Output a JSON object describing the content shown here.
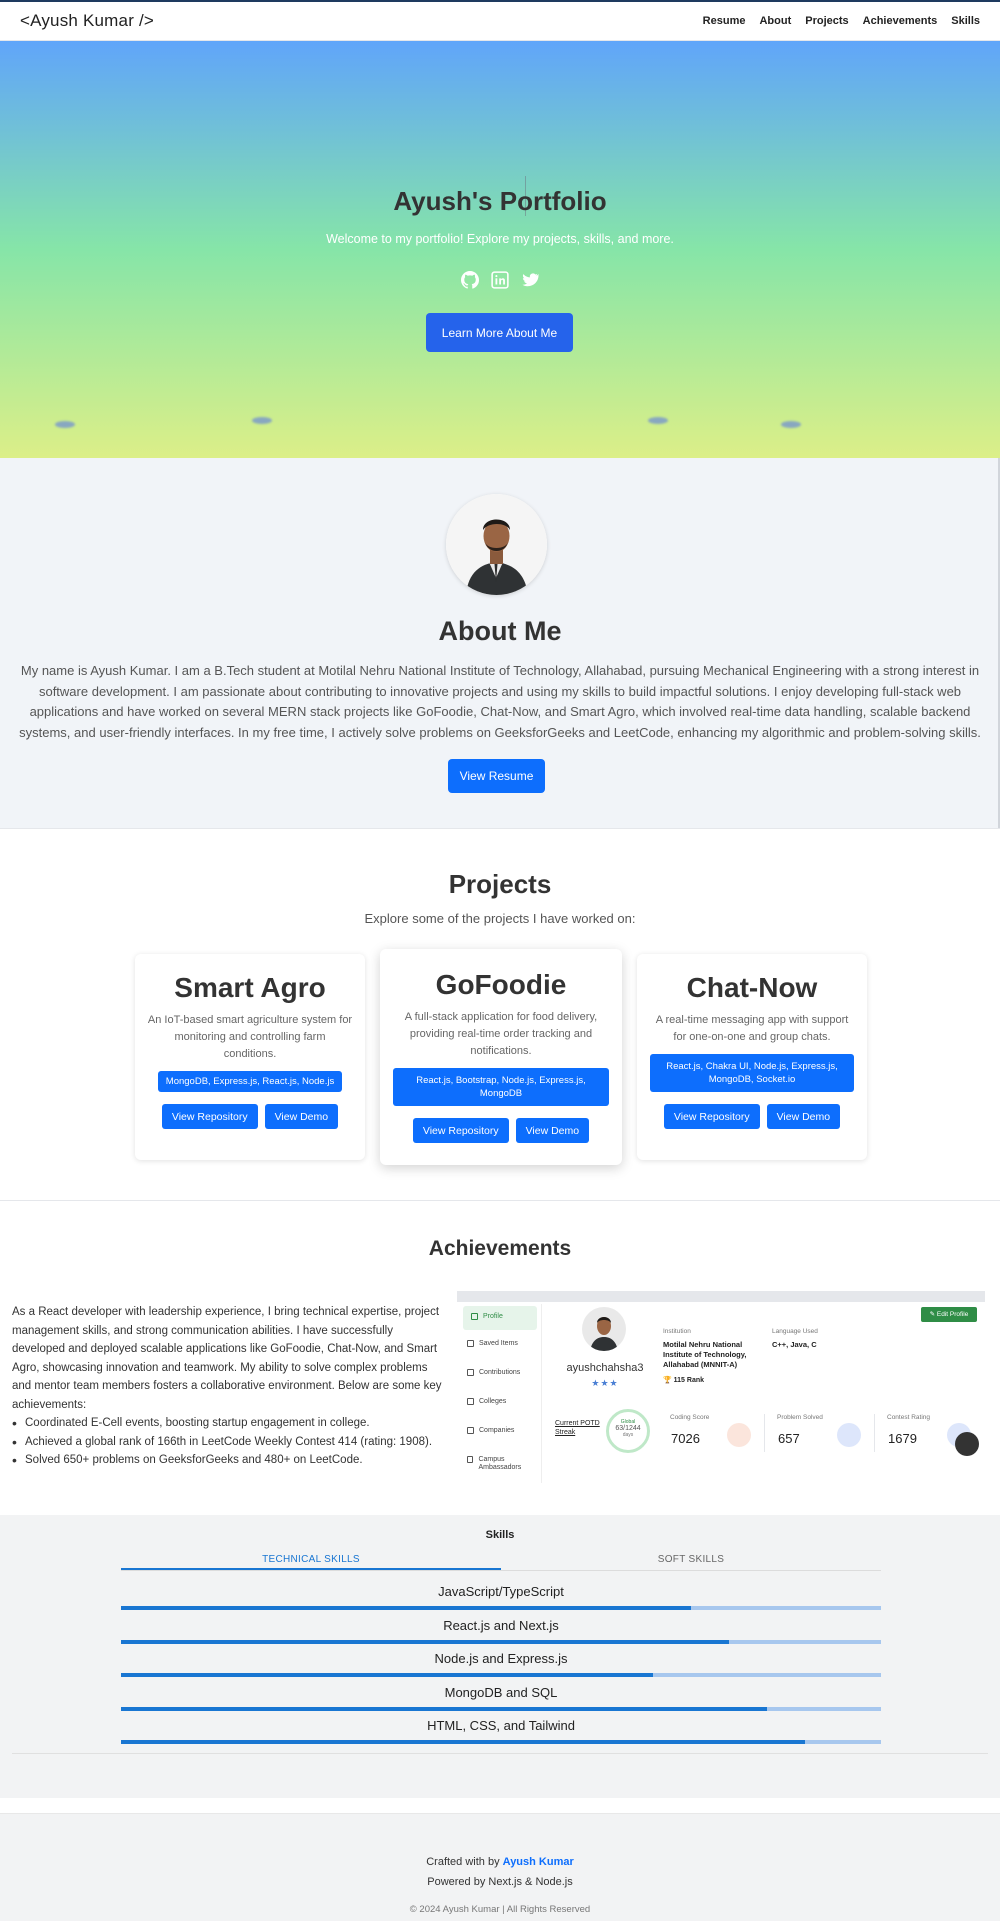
{
  "nav": {
    "brand": "<Ayush Kumar />",
    "links": [
      "Resume",
      "About",
      "Projects",
      "Achievements",
      "Skills"
    ]
  },
  "hero": {
    "title": "Ayush's Portfolio",
    "subtitle": "Welcome to my portfolio! Explore my projects, skills, and more.",
    "icons": [
      "github-icon",
      "linkedin-icon",
      "twitter-icon"
    ],
    "button": "Learn More About Me",
    "gradient": [
      "#60a5fa",
      "#86e5a8",
      "#dcef88"
    ]
  },
  "about": {
    "title": "About Me",
    "text": "My name is Ayush Kumar. I am a B.Tech student at Motilal Nehru National Institute of Technology, Allahabad, pursuing Mechanical Engineering with a strong interest in software development. I am passionate about contributing to innovative projects and using my skills to build impactful solutions. I enjoy developing full-stack web applications and have worked on several MERN stack projects like GoFoodie, Chat-Now, and Smart Agro, which involved real-time data handling, scalable backend systems, and user-friendly interfaces. In my free time, I actively solve problems on GeeksforGeeks and LeetCode, enhancing my algorithmic and problem-solving skills.",
    "button": "View Resume"
  },
  "projects": {
    "title": "Projects",
    "subtitle": "Explore some of the projects I have worked on:",
    "items": [
      {
        "name": "Smart Agro",
        "desc": "An IoT-based smart agriculture system for monitoring and controlling farm conditions.",
        "tech": "MongoDB, Express.js, React.js, Node.js",
        "repo": "View Repository",
        "demo": "View Demo"
      },
      {
        "name": "GoFoodie",
        "desc": "A full-stack application for food delivery, providing real-time order tracking and notifications.",
        "tech": "React.js, Bootstrap, Node.js, Express.js, MongoDB",
        "repo": "View Repository",
        "demo": "View Demo"
      },
      {
        "name": "Chat-Now",
        "desc": "A real-time messaging app with support for one-on-one and group chats.",
        "tech": "React.js, Chakra UI, Node.js, Express.js, MongoDB, Socket.io",
        "repo": "View Repository",
        "demo": "View Demo"
      }
    ]
  },
  "achievements": {
    "title": "Achievements",
    "intro": "As a React developer with leadership experience, I bring technical expertise, project management skills, and strong communication abilities. I have successfully developed and deployed scalable applications like GoFoodie, Chat-Now, and Smart Agro, showcasing innovation and teamwork. My ability to solve complex problems and mentor team members fosters a collaborative environment. Below are some key achievements:",
    "list": [
      "Coordinated E-Cell events, boosting startup engagement in college.",
      "Achieved a global rank of 166th in LeetCode Weekly Contest 414 (rating: 1908).",
      "Solved 650+ problems on GeeksforGeeks and 480+ on LeetCode."
    ],
    "screenshot": {
      "sidebar": [
        "Profile",
        "Saved Items",
        "Contributions",
        "Colleges",
        "Companies",
        "Campus Ambassadors"
      ],
      "username": "ayushchahsha3",
      "stars": "★★★",
      "edit": "✎ Edit Profile",
      "institution_label": "Institution",
      "institution": "Motilal Nehru National Institute of Technology, Allahabad (MNNIT-A)",
      "rank": "🏆 115 Rank",
      "language_label": "Language Used",
      "language": "C++, Java, C",
      "potd": "Current POTD Streak",
      "streak_top": "Global",
      "streak": "63/1244",
      "streak_unit": "days",
      "coding_label": "Coding Score",
      "coding": "7026",
      "solved_label": "Problem Solved",
      "solved": "657",
      "rating_label": "Contest Rating",
      "rating": "1679"
    }
  },
  "skills": {
    "title": "Skills",
    "tabs": [
      "TECHNICAL SKILLS",
      "SOFT SKILLS"
    ],
    "items": [
      {
        "name": "JavaScript/TypeScript",
        "level": 0.75
      },
      {
        "name": "React.js and Next.js",
        "level": 0.8
      },
      {
        "name": "Node.js and Express.js",
        "level": 0.7
      },
      {
        "name": "MongoDB and SQL",
        "level": 0.85
      },
      {
        "name": "HTML, CSS, and Tailwind",
        "level": 0.9
      }
    ]
  },
  "footer": {
    "crafted": "Crafted with by",
    "author": "Ayush Kumar",
    "powered": "Powered by Next.js & Node.js",
    "copyright": "© 2024 Ayush Kumar | All Rights Reserved"
  }
}
